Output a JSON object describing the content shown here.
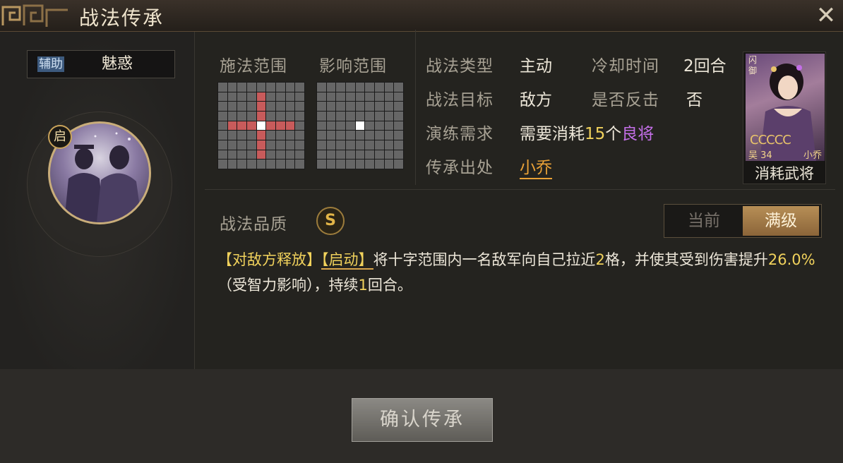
{
  "window": {
    "title": "战法传承"
  },
  "left": {
    "skill_type": "辅助",
    "skill_name": "魅惑",
    "start_badge": "启"
  },
  "ranges": {
    "cast_label": "施法范围",
    "effect_label": "影响范围"
  },
  "info": {
    "type_label": "战法类型",
    "type_value": "主动",
    "cooldown_label": "冷却时间",
    "cooldown_value": "2回合",
    "target_label": "战法目标",
    "target_value": "敌方",
    "counter_label": "是否反击",
    "counter_value": "否",
    "drill_label": "演练需求",
    "drill_prefix": "需要消耗",
    "drill_count": "15",
    "drill_unit": "个",
    "drill_item": "良将",
    "source_label": "传承出处",
    "source_value": "小乔"
  },
  "general_card": {
    "faction": "吴",
    "level": "34",
    "name": "小乔",
    "footer": "消耗武将",
    "stars": "CCCCC",
    "tags": "闪 御"
  },
  "quality": {
    "label": "战法品质",
    "grade": "S"
  },
  "toggle": {
    "current": "当前",
    "max": "满级"
  },
  "description": {
    "tag1": "【对敌方释放】",
    "tag2": "【启动】",
    "text1": "将十字范围内一名敌军向自己拉近",
    "num1": "2",
    "text2": "格，并使其受到伤害提升",
    "num2": "26.0%",
    "text3": "（受智力影响），持续",
    "num3": "1",
    "text4": "回合。"
  },
  "footer": {
    "confirm": "确认传承"
  },
  "colors": {
    "accent": "#f1d25c",
    "purple": "#c46fe8",
    "gold": "#c9a35a"
  }
}
